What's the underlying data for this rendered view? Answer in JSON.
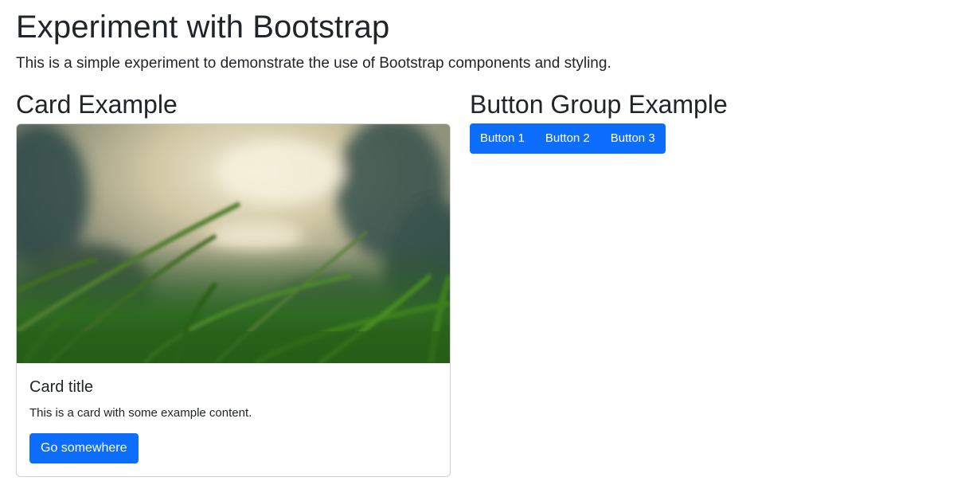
{
  "page": {
    "title": "Experiment with Bootstrap",
    "lead": "This is a simple experiment to demonstrate the use of Bootstrap components and styling."
  },
  "card_section": {
    "heading": "Card Example",
    "card": {
      "image_icon": "grass-photo",
      "title": "Card title",
      "text": "This is a card with some example content.",
      "button_label": "Go somewhere"
    }
  },
  "button_section": {
    "heading": "Button Group Example",
    "buttons": [
      "Button 1",
      "Button 2",
      "Button 3"
    ]
  },
  "colors": {
    "primary": "#0d6efd",
    "text": "#212529"
  }
}
